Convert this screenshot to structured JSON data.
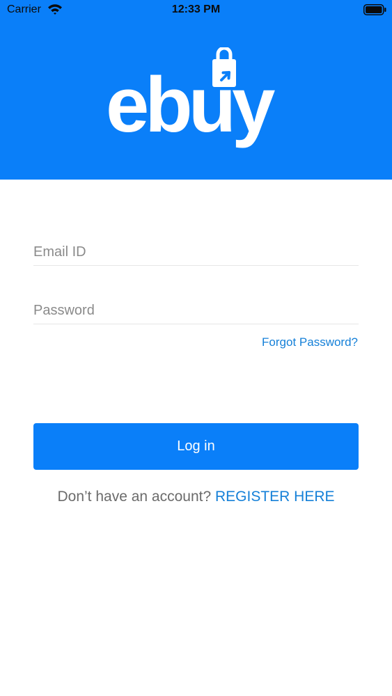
{
  "status_bar": {
    "carrier": "Carrier",
    "time": "12:33 PM"
  },
  "header": {
    "logo_text": "ebuy",
    "background": "#0a7ff9"
  },
  "form": {
    "email_placeholder": "Email ID",
    "password_placeholder": "Password",
    "forgot_password": "Forgot Password?",
    "login_label": "Log in"
  },
  "register": {
    "prompt": "Don’t have an account? ",
    "link": "REGISTER HERE"
  },
  "colors": {
    "brand_blue": "#0a7ff9",
    "link_blue": "#1580d8",
    "muted_text": "#6b6b6b"
  },
  "icons": [
    "wifi-icon",
    "battery-icon",
    "shopping-bag-icon",
    "cursor-arrow-icon"
  ]
}
